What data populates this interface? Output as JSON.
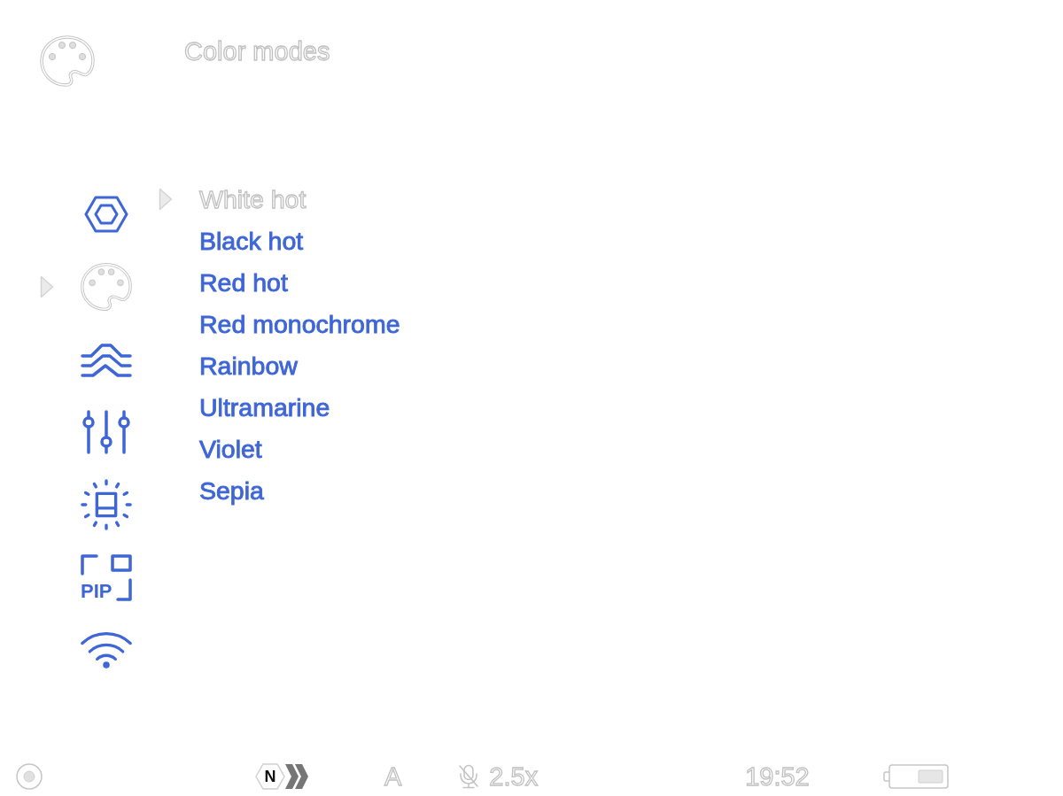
{
  "header": {
    "title": "Color modes"
  },
  "side_menu": {
    "items": [
      {
        "kind": "hexagon",
        "selected": false
      },
      {
        "kind": "palette",
        "selected": true
      },
      {
        "kind": "waves",
        "selected": false
      },
      {
        "kind": "sliders",
        "selected": false
      },
      {
        "kind": "brightness",
        "selected": false
      },
      {
        "kind": "pip",
        "label": "PIP",
        "selected": false
      },
      {
        "kind": "wifi",
        "selected": false
      }
    ]
  },
  "color_modes": {
    "items": [
      {
        "label": "White hot",
        "selected": true
      },
      {
        "label": "Black hot",
        "selected": false
      },
      {
        "label": "Red hot",
        "selected": false
      },
      {
        "label": "Red monochrome",
        "selected": false
      },
      {
        "label": "Rainbow",
        "selected": false
      },
      {
        "label": "Ultramarine",
        "selected": false
      },
      {
        "label": "Violet",
        "selected": false
      },
      {
        "label": "Sepia",
        "selected": false
      }
    ]
  },
  "status_bar": {
    "badge": "N",
    "indicator": "A",
    "mic_muted": true,
    "zoom": "2.5x",
    "time": "19:52"
  }
}
